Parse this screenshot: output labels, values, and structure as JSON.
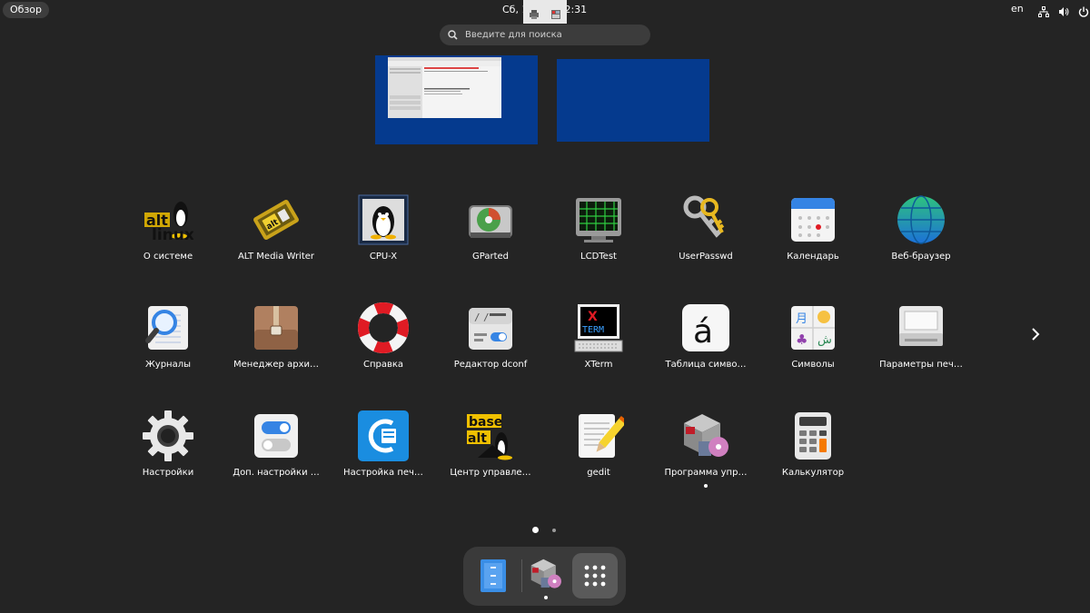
{
  "topbar": {
    "activities_label": "Обзор",
    "clock_left": "Сб, 16",
    "clock_right": "12:31",
    "language": "en",
    "tray_icons": [
      "network-icon",
      "volume-icon",
      "power-icon"
    ]
  },
  "search": {
    "placeholder": "Введите для поиска"
  },
  "apps": [
    {
      "label": "О системе",
      "icon": "altlinux-icon"
    },
    {
      "label": "ALT Media Writer",
      "icon": "media-writer-icon"
    },
    {
      "label": "CPU-X",
      "icon": "cpu-x-icon"
    },
    {
      "label": "GParted",
      "icon": "gparted-icon"
    },
    {
      "label": "LCDTest",
      "icon": "lcdtest-icon"
    },
    {
      "label": "UserPasswd",
      "icon": "keys-icon"
    },
    {
      "label": "Календарь",
      "icon": "calendar-icon"
    },
    {
      "label": "Веб-браузер",
      "icon": "web-browser-icon"
    },
    {
      "label": "Журналы",
      "icon": "logs-icon"
    },
    {
      "label": "Менеджер архи…",
      "icon": "archive-manager-icon"
    },
    {
      "label": "Справка",
      "icon": "help-lifebuoy-icon"
    },
    {
      "label": "Редактор dconf",
      "icon": "dconf-editor-icon"
    },
    {
      "label": "XTerm",
      "icon": "xterm-icon"
    },
    {
      "label": "Таблица симво…",
      "icon": "character-map-icon"
    },
    {
      "label": "Символы",
      "icon": "characters-icon"
    },
    {
      "label": "Параметры печ…",
      "icon": "printer-settings-icon"
    },
    {
      "label": "Настройки",
      "icon": "settings-gear-icon"
    },
    {
      "label": "Доп. настройки …",
      "icon": "tweaks-icon"
    },
    {
      "label": "Настройка печ…",
      "icon": "print-config-icon"
    },
    {
      "label": "Центр управле…",
      "icon": "basealt-control-center-icon"
    },
    {
      "label": "gedit",
      "icon": "gedit-icon"
    },
    {
      "label": "Программа упр…",
      "icon": "package-manager-icon"
    },
    {
      "label": "Калькулятор",
      "icon": "calculator-icon"
    }
  ],
  "pagination": {
    "pages": 2,
    "current": 1
  },
  "dock": {
    "items": [
      "file-manager-icon",
      "package-manager-icon",
      "show-apps-grid-icon"
    ]
  },
  "colors": {
    "background": "#242424",
    "workspace": "#053a8e",
    "dock": "#3a3a3a"
  }
}
